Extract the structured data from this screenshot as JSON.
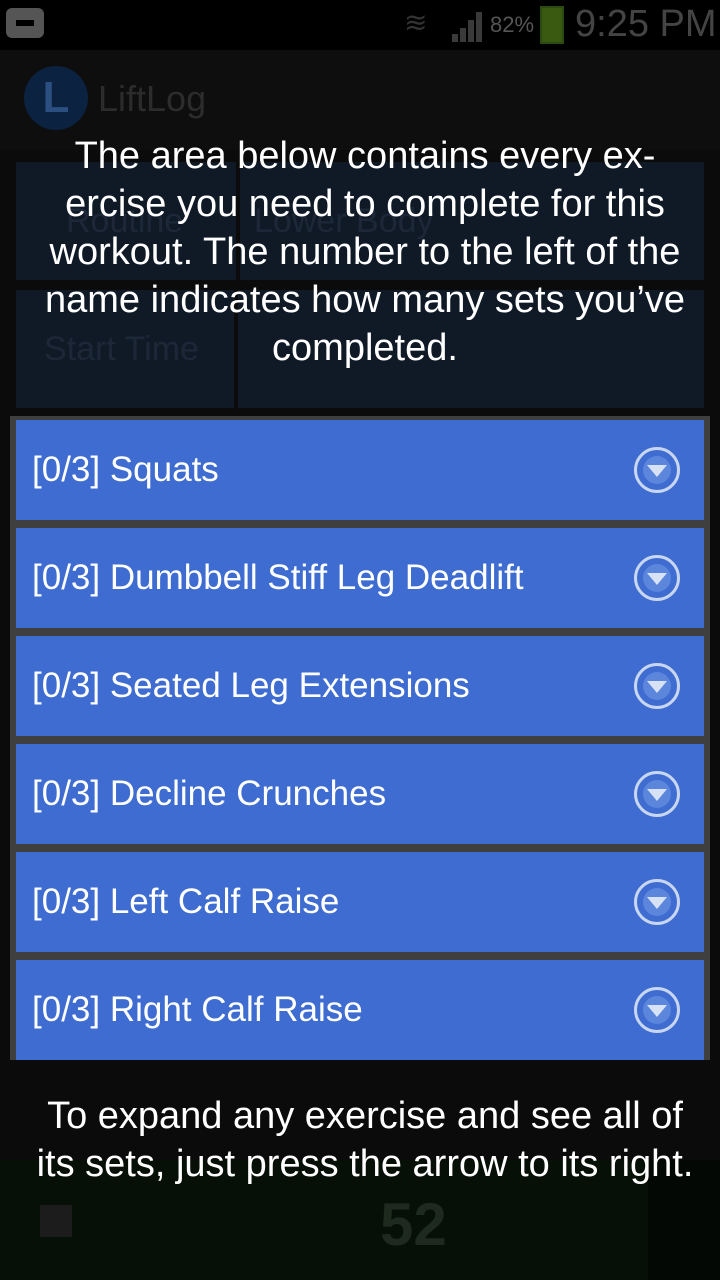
{
  "status_bar": {
    "battery_percent": "82%",
    "time": "9:25 PM"
  },
  "app": {
    "logo_letter": "L",
    "title": "LiftLog",
    "routine_label": "Routine",
    "routine_value": "Lower Body",
    "start_label": "Start Time",
    "bottom_number": "52"
  },
  "overlay": {
    "top_text": "The area below contains every ex-ercise you need to complete for this workout. The number to the left of the name indicates how many sets you’ve completed.",
    "bottom_text": "To expand any exercise and see all of its sets, just press the arrow to its right."
  },
  "exercises": [
    {
      "label": "[0/3] Squats"
    },
    {
      "label": "[0/3] Dumbbell Stiff Leg Deadlift"
    },
    {
      "label": "[0/3] Seated Leg Extensions"
    },
    {
      "label": "[0/3] Decline Crunches"
    },
    {
      "label": "[0/3] Left Calf Raise"
    },
    {
      "label": "[0/3] Right Calf Raise"
    }
  ]
}
